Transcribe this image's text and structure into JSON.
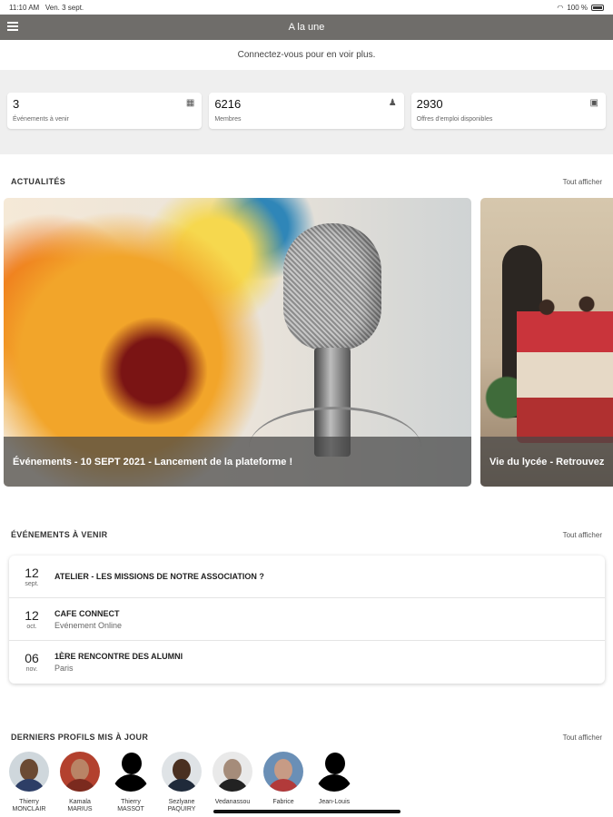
{
  "status_bar": {
    "time": "11:10 AM",
    "date": "Ven. 3 sept.",
    "battery": "100 %"
  },
  "navbar": {
    "title": "A la une"
  },
  "connect_prompt": "Connectez-vous pour en voir plus.",
  "stats": [
    {
      "value": "3",
      "label": "Événements à venir",
      "icon": "calendar-icon"
    },
    {
      "value": "6216",
      "label": "Membres",
      "icon": "members-icon"
    },
    {
      "value": "2930",
      "label": "Offres d'emploi disponibles",
      "icon": "briefcase-icon"
    }
  ],
  "news": {
    "title": "ACTUALITÉS",
    "see_all": "Tout afficher",
    "items": [
      {
        "caption": "Événements - 10 SEPT 2021 - Lancement de la plateforme !"
      },
      {
        "caption": "Vie du lycée - Retrouvez"
      }
    ]
  },
  "events": {
    "title": "ÉVÉNEMENTS À VENIR",
    "see_all": "Tout afficher",
    "items": [
      {
        "day": "12",
        "month": "sept.",
        "title": "ATELIER - LES MISSIONS DE NOTRE ASSOCIATION ?",
        "subtitle": ""
      },
      {
        "day": "12",
        "month": "oct.",
        "title": "CAFE CONNECT",
        "subtitle": "Evénement Online"
      },
      {
        "day": "06",
        "month": "nov.",
        "title": "1ÈRE RENCONTRE DES ALUMNI",
        "subtitle": "Paris"
      }
    ]
  },
  "profiles": {
    "title": "DERNIERS PROFILS MIS À JOUR",
    "see_all": "Tout afficher",
    "items": [
      {
        "first": "Thierry",
        "last": "MONCLAIR"
      },
      {
        "first": "Kamala",
        "last": "MARIUS"
      },
      {
        "first": "Thierry",
        "last": "MASSOT"
      },
      {
        "first": "Sezlyane",
        "last": "PAQUIRY"
      },
      {
        "first": "Vedanassou",
        "last": ""
      },
      {
        "first": "Fabrice",
        "last": ""
      },
      {
        "first": "Jean-Louis",
        "last": ""
      }
    ]
  }
}
